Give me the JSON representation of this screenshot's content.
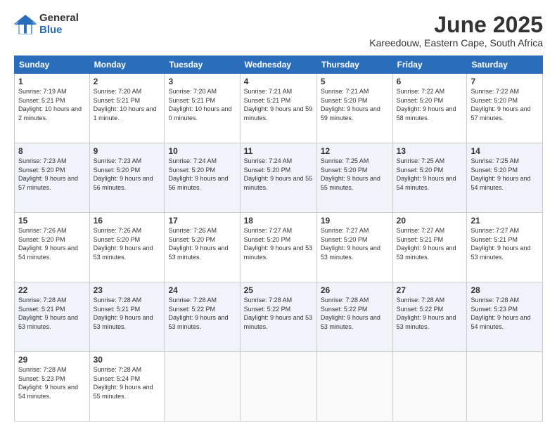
{
  "logo": {
    "general": "General",
    "blue": "Blue"
  },
  "title": "June 2025",
  "location": "Kareedouw, Eastern Cape, South Africa",
  "weekdays": [
    "Sunday",
    "Monday",
    "Tuesday",
    "Wednesday",
    "Thursday",
    "Friday",
    "Saturday"
  ],
  "weeks": [
    [
      {
        "day": "1",
        "sunrise": "7:19 AM",
        "sunset": "5:21 PM",
        "daylight": "10 hours and 2 minutes."
      },
      {
        "day": "2",
        "sunrise": "7:20 AM",
        "sunset": "5:21 PM",
        "daylight": "10 hours and 1 minute."
      },
      {
        "day": "3",
        "sunrise": "7:20 AM",
        "sunset": "5:21 PM",
        "daylight": "10 hours and 0 minutes."
      },
      {
        "day": "4",
        "sunrise": "7:21 AM",
        "sunset": "5:21 PM",
        "daylight": "9 hours and 59 minutes."
      },
      {
        "day": "5",
        "sunrise": "7:21 AM",
        "sunset": "5:20 PM",
        "daylight": "9 hours and 59 minutes."
      },
      {
        "day": "6",
        "sunrise": "7:22 AM",
        "sunset": "5:20 PM",
        "daylight": "9 hours and 58 minutes."
      },
      {
        "day": "7",
        "sunrise": "7:22 AM",
        "sunset": "5:20 PM",
        "daylight": "9 hours and 57 minutes."
      }
    ],
    [
      {
        "day": "8",
        "sunrise": "7:23 AM",
        "sunset": "5:20 PM",
        "daylight": "9 hours and 57 minutes."
      },
      {
        "day": "9",
        "sunrise": "7:23 AM",
        "sunset": "5:20 PM",
        "daylight": "9 hours and 56 minutes."
      },
      {
        "day": "10",
        "sunrise": "7:24 AM",
        "sunset": "5:20 PM",
        "daylight": "9 hours and 56 minutes."
      },
      {
        "day": "11",
        "sunrise": "7:24 AM",
        "sunset": "5:20 PM",
        "daylight": "9 hours and 55 minutes."
      },
      {
        "day": "12",
        "sunrise": "7:25 AM",
        "sunset": "5:20 PM",
        "daylight": "9 hours and 55 minutes."
      },
      {
        "day": "13",
        "sunrise": "7:25 AM",
        "sunset": "5:20 PM",
        "daylight": "9 hours and 54 minutes."
      },
      {
        "day": "14",
        "sunrise": "7:25 AM",
        "sunset": "5:20 PM",
        "daylight": "9 hours and 54 minutes."
      }
    ],
    [
      {
        "day": "15",
        "sunrise": "7:26 AM",
        "sunset": "5:20 PM",
        "daylight": "9 hours and 54 minutes."
      },
      {
        "day": "16",
        "sunrise": "7:26 AM",
        "sunset": "5:20 PM",
        "daylight": "9 hours and 53 minutes."
      },
      {
        "day": "17",
        "sunrise": "7:26 AM",
        "sunset": "5:20 PM",
        "daylight": "9 hours and 53 minutes."
      },
      {
        "day": "18",
        "sunrise": "7:27 AM",
        "sunset": "5:20 PM",
        "daylight": "9 hours and 53 minutes."
      },
      {
        "day": "19",
        "sunrise": "7:27 AM",
        "sunset": "5:20 PM",
        "daylight": "9 hours and 53 minutes."
      },
      {
        "day": "20",
        "sunrise": "7:27 AM",
        "sunset": "5:21 PM",
        "daylight": "9 hours and 53 minutes."
      },
      {
        "day": "21",
        "sunrise": "7:27 AM",
        "sunset": "5:21 PM",
        "daylight": "9 hours and 53 minutes."
      }
    ],
    [
      {
        "day": "22",
        "sunrise": "7:28 AM",
        "sunset": "5:21 PM",
        "daylight": "9 hours and 53 minutes."
      },
      {
        "day": "23",
        "sunrise": "7:28 AM",
        "sunset": "5:21 PM",
        "daylight": "9 hours and 53 minutes."
      },
      {
        "day": "24",
        "sunrise": "7:28 AM",
        "sunset": "5:22 PM",
        "daylight": "9 hours and 53 minutes."
      },
      {
        "day": "25",
        "sunrise": "7:28 AM",
        "sunset": "5:22 PM",
        "daylight": "9 hours and 53 minutes."
      },
      {
        "day": "26",
        "sunrise": "7:28 AM",
        "sunset": "5:22 PM",
        "daylight": "9 hours and 53 minutes."
      },
      {
        "day": "27",
        "sunrise": "7:28 AM",
        "sunset": "5:22 PM",
        "daylight": "9 hours and 53 minutes."
      },
      {
        "day": "28",
        "sunrise": "7:28 AM",
        "sunset": "5:23 PM",
        "daylight": "9 hours and 54 minutes."
      }
    ],
    [
      {
        "day": "29",
        "sunrise": "7:28 AM",
        "sunset": "5:23 PM",
        "daylight": "9 hours and 54 minutes."
      },
      {
        "day": "30",
        "sunrise": "7:28 AM",
        "sunset": "5:24 PM",
        "daylight": "9 hours and 55 minutes."
      },
      null,
      null,
      null,
      null,
      null
    ]
  ]
}
